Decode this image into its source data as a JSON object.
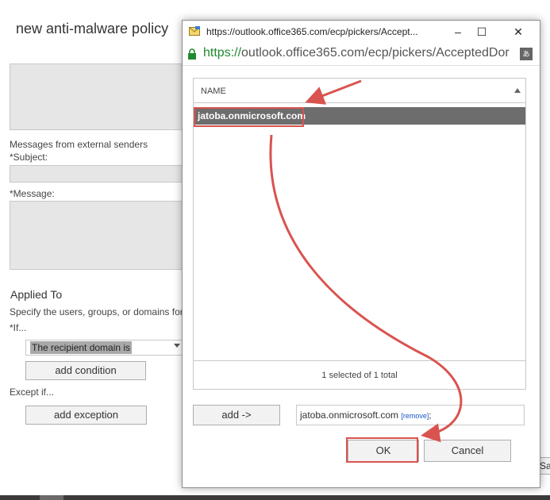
{
  "background": {
    "page_title": "new anti-malware policy",
    "external_senders_label": "Messages from external senders",
    "subject_label": "*Subject:",
    "message_label": "*Message:",
    "applied_to_heading": "Applied To",
    "applied_to_desc": "Specify the users, groups, or domains for",
    "if_label": "*If...",
    "recipient_select_value": "The recipient domain is",
    "add_condition_label": "add condition",
    "except_if_label": "Except if...",
    "add_exception_label": "add exception",
    "side_button_label": "Sa"
  },
  "window": {
    "title": "https://outlook.office365.com/ecp/pickers/Accept...",
    "minimize": "–",
    "maximize": "☐",
    "close": "✕",
    "url_scheme": "https://",
    "url_rest": "outlook.office365.com/ecp/pickers/AcceptedDor",
    "translate_icon": "あ",
    "list": {
      "column_header": "NAME",
      "rows": [
        "jatoba.onmicrosoft.com"
      ],
      "count_text": "1 selected of 1 total"
    },
    "add_button_label": "add ->",
    "selected_value": "jatoba.onmicrosoft.com",
    "remove_link": "[remove]",
    "separator": ";",
    "ok_label": "OK",
    "cancel_label": "Cancel"
  },
  "colors": {
    "annotation_red": "#d9534f",
    "url_green": "#1f8a2e",
    "selected_row": "#6d6d6d"
  }
}
